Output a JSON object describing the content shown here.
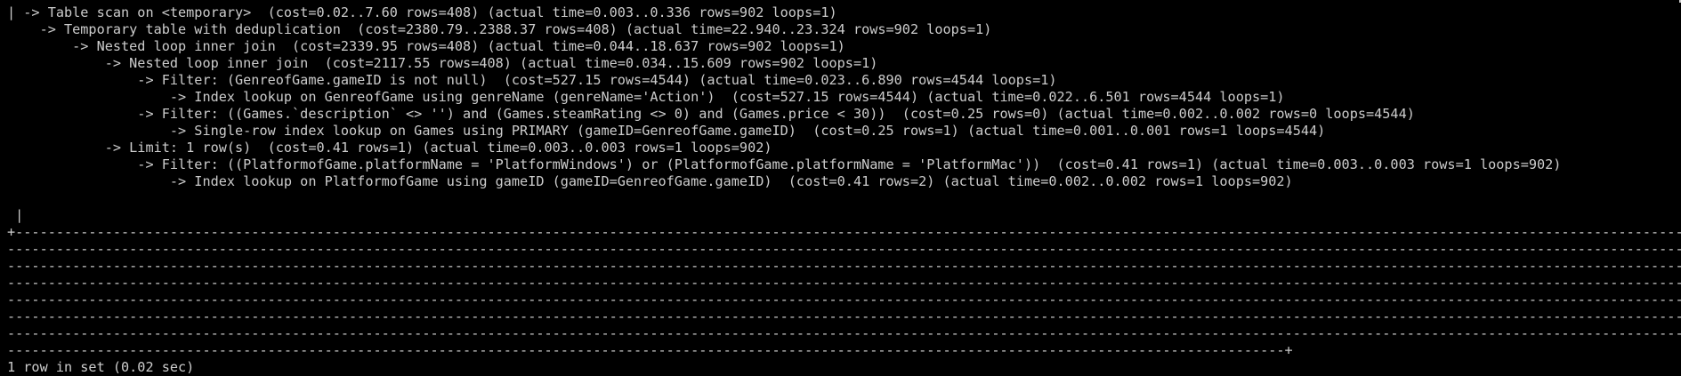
{
  "terminal": {
    "plan_lines": [
      "| -> Table scan on <temporary>  (cost=0.02..7.60 rows=408) (actual time=0.003..0.336 rows=902 loops=1)",
      "    -> Temporary table with deduplication  (cost=2380.79..2388.37 rows=408) (actual time=22.940..23.324 rows=902 loops=1)",
      "        -> Nested loop inner join  (cost=2339.95 rows=408) (actual time=0.044..18.637 rows=902 loops=1)",
      "            -> Nested loop inner join  (cost=2117.55 rows=408) (actual time=0.034..15.609 rows=902 loops=1)",
      "                -> Filter: (GenreofGame.gameID is not null)  (cost=527.15 rows=4544) (actual time=0.023..6.890 rows=4544 loops=1)",
      "                    -> Index lookup on GenreofGame using genreName (genreName='Action')  (cost=527.15 rows=4544) (actual time=0.022..6.501 rows=4544 loops=1)",
      "                -> Filter: ((Games.`description` <> '') and (Games.steamRating <> 0) and (Games.price < 30))  (cost=0.25 rows=0) (actual time=0.002..0.002 rows=0 loops=4544)",
      "                    -> Single-row index lookup on Games using PRIMARY (gameID=GenreofGame.gameID)  (cost=0.25 rows=1) (actual time=0.001..0.001 rows=1 loops=4544)",
      "            -> Limit: 1 row(s)  (cost=0.41 rows=1) (actual time=0.003..0.003 rows=1 loops=902)",
      "                -> Filter: ((PlatformofGame.platformName = 'PlatformWindows') or (PlatformofGame.platformName = 'PlatformMac'))  (cost=0.41 rows=1) (actual time=0.003..0.003 rows=1 loops=902)",
      "                    -> Index lookup on PlatformofGame using gameID (gameID=GenreofGame.gameID)  (cost=0.41 rows=2) (actual time=0.002..0.002 rows=1 loops=902)",
      "",
      " |"
    ],
    "border_lines": [
      "+--------------------------------------------------------------------------------------------------------------------------------------------------------------------------------------------------------------",
      "---------------------------------------------------------------------------------------------------------------------------------------------------------------------------------------------------------------",
      "---------------------------------------------------------------------------------------------------------------------------------------------------------------------------------------------------------------",
      "---------------------------------------------------------------------------------------------------------------------------------------------------------------------------------------------------------------",
      "---------------------------------------------------------------------------------------------------------------------------------------------------------------------------------------------------------------",
      "---------------------------------------------------------------------------------------------------------------------------------------------------------------------------------------------------------------",
      "---------------------------------------------------------------------------------------------------------------------------------------------------------------------------------------------------------------",
      "-------------------------------------------------------------------------------------------------------------------------------------------------------------+"
    ],
    "result_summary": "1 row in set (0.02 sec)"
  },
  "colors": {
    "background": "#000000",
    "text": "#cccccc"
  }
}
